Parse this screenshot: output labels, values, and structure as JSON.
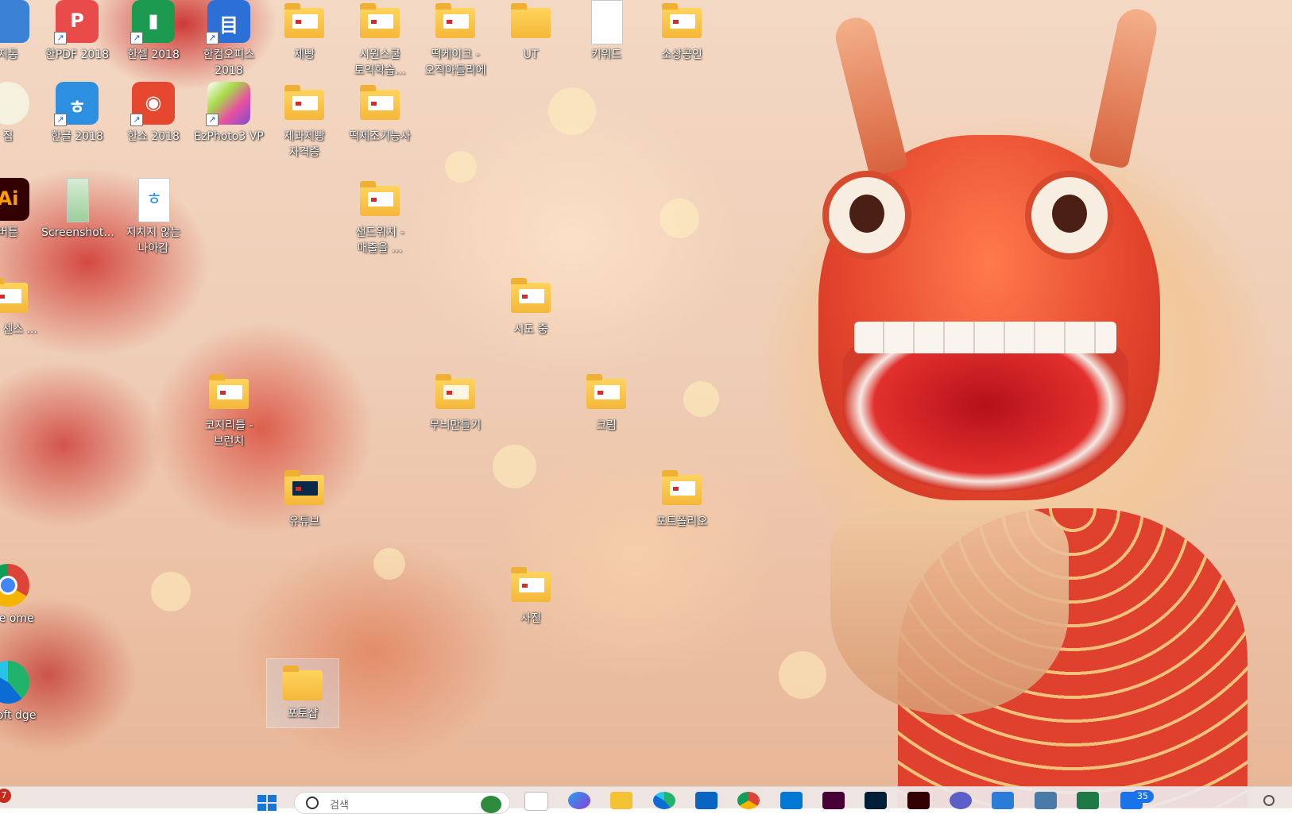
{
  "desktop": {
    "icons": [
      {
        "label": "지통"
      },
      {
        "label": "한PDF 2018"
      },
      {
        "label": "한셀 2018"
      },
      {
        "label": "한컴오피스 2018"
      },
      {
        "label": "제빵"
      },
      {
        "label": "시원스쿨 토익학습..."
      },
      {
        "label": "떡케이크 - 오직아들리에"
      },
      {
        "label": "UT"
      },
      {
        "label": "키워드"
      },
      {
        "label": "소상공인"
      },
      {
        "label": "집"
      },
      {
        "label": "한글 2018"
      },
      {
        "label": "한쇼 2018"
      },
      {
        "label": "EzPhoto3 VP"
      },
      {
        "label": "제과제빵 자격증"
      },
      {
        "label": "떡제조기능사"
      },
      {
        "label": "버튼"
      },
      {
        "label": "Screenshot..."
      },
      {
        "label": "지치지 않는 나아감"
      },
      {
        "label": "샌드위치 - 매출을 ..."
      },
      {
        "label": "시도 중"
      },
      {
        "label": "비아 센스 ..."
      },
      {
        "label": "코지리틀 - 브런치"
      },
      {
        "label": "무늬만들기"
      },
      {
        "label": "크림"
      },
      {
        "label": "유튜브"
      },
      {
        "label": "포트폴리오"
      },
      {
        "label": "사진"
      },
      {
        "label": "ogle ome"
      },
      {
        "label": "rosoft dge"
      },
      {
        "label": "포토샵"
      }
    ]
  },
  "taskbar": {
    "left_badge": "7",
    "search_placeholder": "검색",
    "notification_count": "35"
  }
}
